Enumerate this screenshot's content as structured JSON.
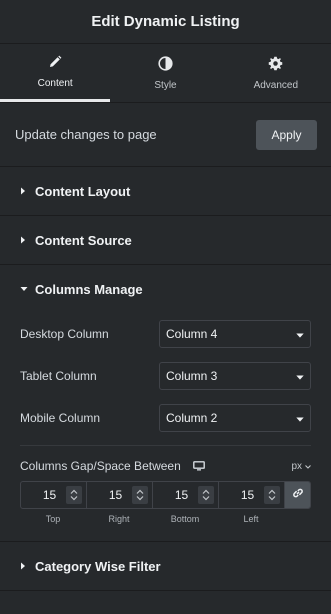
{
  "header": {
    "title": "Edit Dynamic Listing"
  },
  "tabs": [
    {
      "label": "Content",
      "icon": "pencil-icon",
      "active": true
    },
    {
      "label": "Style",
      "icon": "half-circle-icon",
      "active": false
    },
    {
      "label": "Advanced",
      "icon": "gear-icon",
      "active": false
    }
  ],
  "apply": {
    "text": "Update changes to page",
    "button_label": "Apply"
  },
  "sections": {
    "content_layout": {
      "title": "Content Layout"
    },
    "content_source": {
      "title": "Content Source"
    },
    "columns_manage": {
      "title": "Columns Manage"
    },
    "category_filter": {
      "title": "Category Wise Filter"
    }
  },
  "columns": {
    "desktop": {
      "label": "Desktop Column",
      "value": "Column 4"
    },
    "tablet": {
      "label": "Tablet Column",
      "value": "Column 3"
    },
    "mobile": {
      "label": "Mobile Column",
      "value": "Column 2"
    }
  },
  "gap": {
    "label": "Columns Gap/Space Between",
    "unit": "px",
    "top": {
      "value": "15",
      "label": "Top"
    },
    "right": {
      "value": "15",
      "label": "Right"
    },
    "bottom": {
      "value": "15",
      "label": "Bottom"
    },
    "left": {
      "value": "15",
      "label": "Left"
    }
  },
  "colors": {
    "panel_bg": "#26292c",
    "button_bg": "#4d5359",
    "border": "#404349"
  }
}
